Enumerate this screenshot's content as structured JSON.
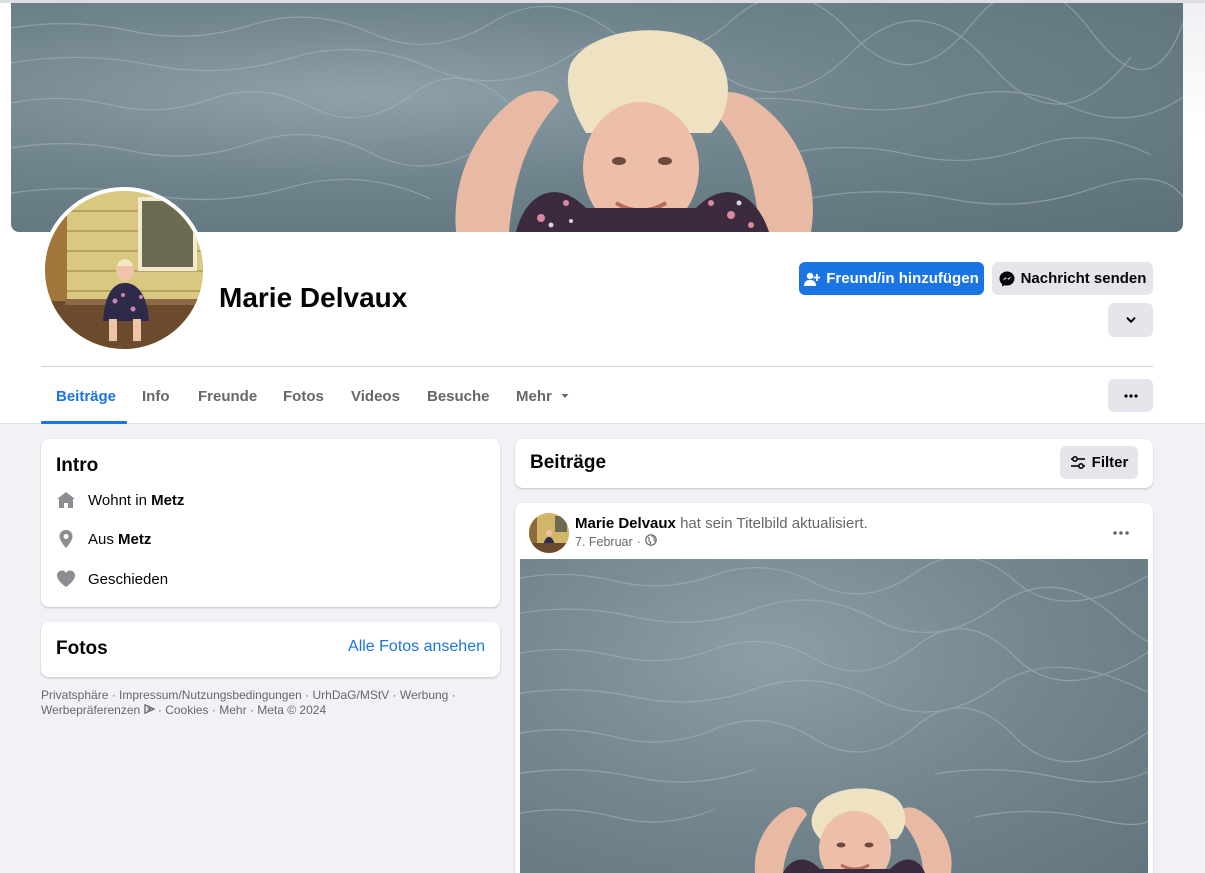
{
  "profile": {
    "name": "Marie Delvaux"
  },
  "actions": {
    "add_friend_label": "Freund/in hinzufügen",
    "message_label": "Nachricht senden"
  },
  "tabs": [
    {
      "label": "Beiträge",
      "active": true
    },
    {
      "label": "Info"
    },
    {
      "label": "Freunde"
    },
    {
      "label": "Fotos"
    },
    {
      "label": "Videos"
    },
    {
      "label": "Besuche"
    },
    {
      "label": "Mehr"
    }
  ],
  "intro": {
    "title": "Intro",
    "lives_prefix": "Wohnt in ",
    "lives_city": "Metz",
    "from_prefix": "Aus ",
    "from_city": "Metz",
    "relationship": "Geschieden"
  },
  "photos": {
    "title": "Fotos",
    "see_all_label": "Alle Fotos ansehen"
  },
  "footer": {
    "links": [
      "Privatsphäre",
      "Impressum/Nutzungsbedingungen",
      "UrhDaG/MStV",
      "Werbung",
      "Werbepräferenzen",
      "Cookies",
      "Mehr"
    ],
    "copyright": "Meta © 2024"
  },
  "posts_header": {
    "title": "Beiträge",
    "filter_label": "Filter"
  },
  "post": {
    "author": "Marie Delvaux",
    "action_text": "hat sein Titelbild aktualisiert.",
    "date": "7. Februar",
    "separator": "·"
  },
  "colors": {
    "accent": "#1b74e4",
    "page_bg": "#f0f2f5",
    "secondary_btn": "#e4e6eb",
    "muted_text": "#65676b"
  }
}
